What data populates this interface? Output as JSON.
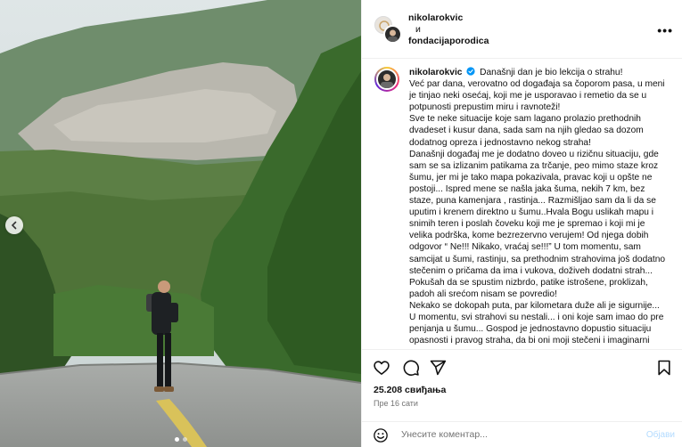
{
  "header": {
    "author_primary": "nikolarokvic",
    "conjunction": "и",
    "author_secondary": "fondacijaporodica",
    "more_glyph": "•••"
  },
  "caption": {
    "username": "nikolarokvic",
    "verified": true,
    "paragraphs": [
      "Današnji dan je bio lekcija o strahu!",
      "Već par dana, verovatno od događaja sa čoporom pasa, u meni je tinjao neki osećaj, koji me je usporavao i remetio da se u potpunosti prepustim miru i ravnoteži!",
      "Sve te neke situacije koje sam lagano prolazio prethodnih dvadeset i kusur dana, sada sam na njih gledao sa dozom dodatnog opreza i jednostavno nekog straha!",
      "Današnji događaj me je dodatno doveo u rizičnu situaciju, gde sam se sa izlizanim patikama za trčanje, peo mimo staze kroz šumu, jer mi je tako mapa pokazivala, pravac koji u opšte ne postoji... Ispred mene se našla jaka šuma, nekih 7 km, bez staze, puna kamenjara , rastinja... Razmišljao sam da li da se uputim i krenem direktno u šumu..Hvala Bogu uslikah mapu i snimih teren i poslah čoveku koji me je spremao i koji mi je velika podrška, kome bezrezervno verujem! Od njega dobih odgovor “ Ne!!! Nikako, vraćaj se!!!” U tom momentu, sam samcijat u šumi, rastinju, sa prethodnim strahovima još dodatno stečenim o pričama da ima i vukova, doživeh dodatni strah...",
      "Pokušah da se spustim nizbrdo, patike istrošene, proklizah, padoh ali srećom nisam se povredio!",
      "Nekako se dokopah puta, par kilometara duže ali je sigurnije...",
      "U momentu, svi strahovi su nestali... i oni koje sam imao do pre penjanja u šumu... Gospod je jednostavno dopustio situaciju opasnosti i pravog straha, da bi oni moji stečeni i imaginarni"
    ]
  },
  "actions": {
    "like_icon": "heart-outline-icon",
    "comment_icon": "speech-bubble-icon",
    "share_icon": "paper-plane-icon",
    "save_icon": "bookmark-icon"
  },
  "stats": {
    "likes": "25.208 свиђања",
    "time": "Пре 16 сати"
  },
  "comment": {
    "placeholder": "Унесите коментар...",
    "post_label": "Објави",
    "post_color": "#b3dbff"
  },
  "carousel": {
    "slide_count": 2,
    "active_index": 0
  },
  "colors": {
    "verified": "#0095f6",
    "muted_text": "#737373",
    "divider": "#efefef"
  }
}
